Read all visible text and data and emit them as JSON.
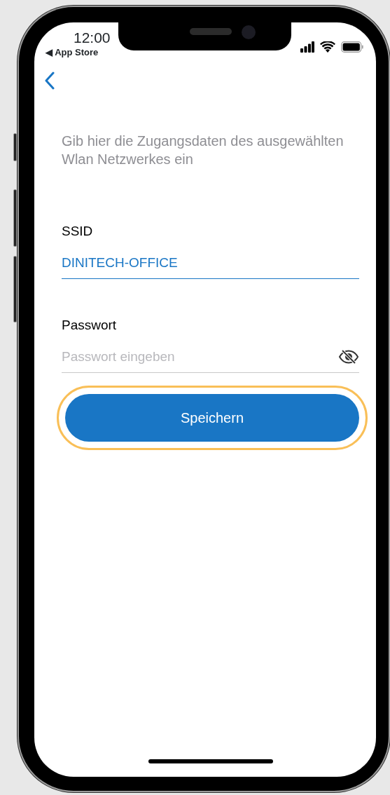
{
  "status_bar": {
    "time": "12:00",
    "back_app": "◀ App Store"
  },
  "intro": "Gib hier die Zugangsdaten des ausgewählten Wlan Netzwerkes ein",
  "fields": [
    {
      "kind": "text",
      "label": "SSID",
      "value": "DINITECH-OFFICE",
      "active": true
    },
    {
      "kind": "password",
      "label": "Passwort",
      "placeholder": "Passwort eingeben",
      "active": false
    }
  ],
  "button": {
    "label": "Speichern",
    "focused": true
  }
}
